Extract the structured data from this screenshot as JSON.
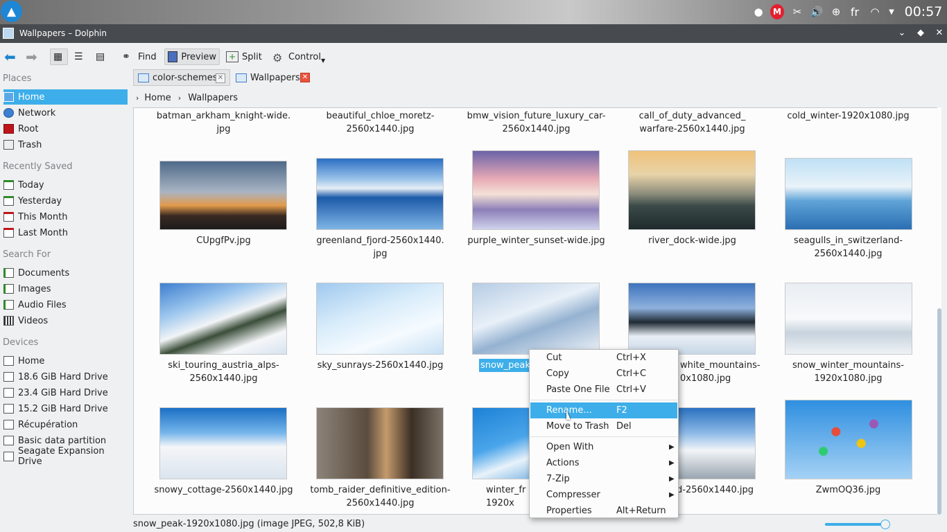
{
  "taskbar": {
    "lang": "fr",
    "clock": "00:57"
  },
  "window": {
    "title": "Wallpapers – Dolphin"
  },
  "toolbar": {
    "find": "Find",
    "preview": "Preview",
    "split": "Split",
    "control": "Control"
  },
  "sidebar": {
    "places": {
      "heading": "Places",
      "items": [
        "Home",
        "Network",
        "Root",
        "Trash"
      ]
    },
    "recent": {
      "heading": "Recently Saved",
      "items": [
        "Today",
        "Yesterday",
        "This Month",
        "Last Month"
      ]
    },
    "search": {
      "heading": "Search For",
      "items": [
        "Documents",
        "Images",
        "Audio Files",
        "Videos"
      ]
    },
    "devices": {
      "heading": "Devices",
      "items": [
        "Home",
        "18.6 GiB Hard Drive",
        "23.4 GiB Hard Drive",
        "15.2 GiB Hard Drive",
        "Récupération",
        "Basic data partition",
        "Seagate Expansion Drive"
      ]
    }
  },
  "tabs": [
    "color-schemes",
    "Wallpapers"
  ],
  "breadcrumb": [
    "Home",
    "Wallpapers"
  ],
  "files": {
    "row0": [
      "batman_arkham_knight-wide.\njpg",
      "beautiful_chloe_moretz-\n2560x1440.jpg",
      "bmw_vision_future_luxury_car-\n2560x1440.jpg",
      "call_of_duty_advanced_\nwarfare-2560x1440.jpg",
      "cold_winter-1920x1080.jpg"
    ],
    "row1": [
      "CUpgfPv.jpg",
      "greenland_fjord-2560x1440.\njpg",
      "purple_winter_sunset-wide.jpg",
      "river_dock-wide.jpg",
      "seagulls_in_switzerland-\n2560x1440.jpg"
    ],
    "row2": [
      "ski_touring_austria_alps-\n2560x1440.jpg",
      "sky_sunrays-2560x1440.jpg",
      "snow_peak-",
      "white_mountains-\n0x1080.jpg",
      "snow_winter_mountains-\n1920x1080.jpg"
    ],
    "row3": [
      "snowy_cottage-2560x1440.jpg",
      "tomb_raider_definitive_edition-\n2560x1440.jpg",
      "winter_fr\n1920x",
      "d-2560x1440.jpg",
      "ZwmOQ36.jpg"
    ]
  },
  "status": "snow_peak-1920x1080.jpg (image JPEG, 502,8 KiB)",
  "context_menu": {
    "items": [
      {
        "label": "Cut",
        "shortcut": "Ctrl+X"
      },
      {
        "label": "Copy",
        "shortcut": "Ctrl+C"
      },
      {
        "label": "Paste One File",
        "shortcut": "Ctrl+V"
      },
      {
        "label": "Rename...",
        "shortcut": "F2"
      },
      {
        "label": "Move to Trash",
        "shortcut": "Del"
      },
      {
        "label": "Open With",
        "shortcut": ""
      },
      {
        "label": "Actions",
        "shortcut": ""
      },
      {
        "label": "7-Zip",
        "shortcut": ""
      },
      {
        "label": "Compresser",
        "shortcut": ""
      },
      {
        "label": "Properties",
        "shortcut": "Alt+Return"
      }
    ]
  },
  "colors": {
    "accent": "#3daee9",
    "titlebar": "#474b4f"
  }
}
